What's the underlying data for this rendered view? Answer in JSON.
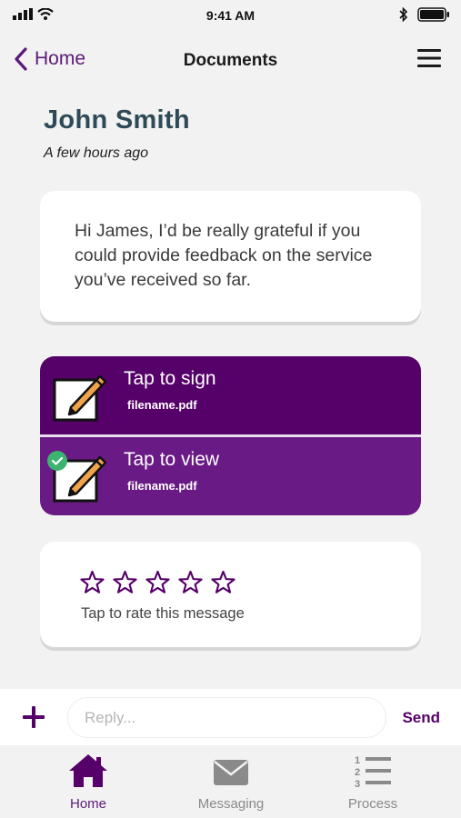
{
  "status_bar": {
    "time": "9:41 AM"
  },
  "nav": {
    "back_label": "Home",
    "title": "Documents"
  },
  "message": {
    "sender": "John Smith",
    "time": "A few hours ago",
    "text": "Hi James, I’d be really grateful if you could provide feedback on the service you’ve received so far."
  },
  "documents": [
    {
      "title": "Tap to sign",
      "filename": "filename.pdf",
      "signed": false
    },
    {
      "title": "Tap to view",
      "filename": "filename.pdf",
      "signed": true
    }
  ],
  "rating": {
    "stars_total": 5,
    "stars_selected": 0,
    "label": "Tap to rate this message"
  },
  "reply": {
    "placeholder": "Reply...",
    "value": "",
    "send_label": "Send"
  },
  "tabs": [
    {
      "label": "Home",
      "icon": "home-icon",
      "active": true
    },
    {
      "label": "Messaging",
      "icon": "envelope-icon",
      "active": false
    },
    {
      "label": "Process",
      "icon": "numbered-list-icon",
      "active": false
    }
  ],
  "colors": {
    "brand_purple": "#560069",
    "brand_purple_light": "#6a1a85",
    "name_color": "#2e4a57",
    "check_green": "#3cb371",
    "inactive_tab": "#8a8a8a"
  }
}
